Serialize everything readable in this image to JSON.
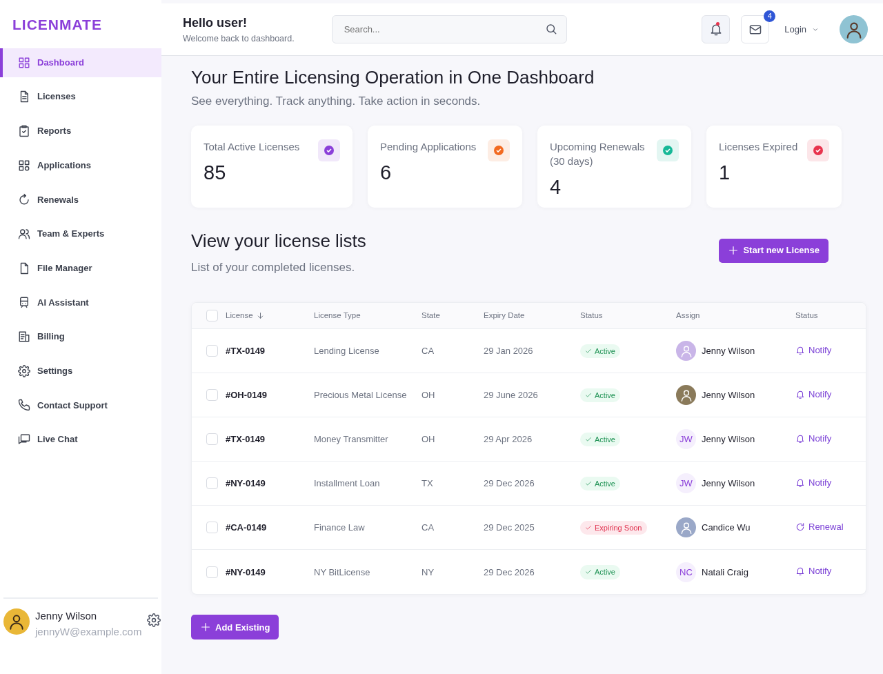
{
  "logo": "LICENMATE",
  "sidebar": {
    "items": [
      {
        "label": "Dashboard",
        "selected": true
      },
      {
        "label": "Licenses",
        "selected": false
      },
      {
        "label": "Reports",
        "selected": false
      },
      {
        "label": "Applications",
        "selected": false
      },
      {
        "label": "Renewals",
        "selected": false
      },
      {
        "label": "Team & Experts",
        "selected": false
      },
      {
        "label": "File Manager",
        "selected": false
      },
      {
        "label": "AI Assistant",
        "selected": false
      },
      {
        "label": "Billing",
        "selected": false
      },
      {
        "label": "Settings",
        "selected": false
      },
      {
        "label": "Contact Support",
        "selected": false
      },
      {
        "label": "Live Chat",
        "selected": false
      }
    ],
    "user": {
      "name": "Jenny Wilson",
      "email": "jennyW@example.com"
    }
  },
  "header": {
    "greeting": "Hello user!",
    "subtitle": "Welcome back to dashboard.",
    "search": {
      "placeholder": "Search..."
    },
    "bell_unread": true,
    "mail_count": "4",
    "login": "Login"
  },
  "hero": {
    "title": "Your Entire Licensing Operation in One Dashboard",
    "subtitle": "See everything. Track anything. Take action in seconds."
  },
  "stats": [
    {
      "label": "Total Active Licenses",
      "value": "85",
      "color": "#8b3fd9"
    },
    {
      "label": "Pending Applications",
      "value": "6",
      "color": "#f26a21"
    },
    {
      "label": "Upcoming Renewals (30 days)",
      "value": "4",
      "color": "#17b897"
    },
    {
      "label": "Licenses Expired",
      "value": "1",
      "color": "#e8344e"
    }
  ],
  "list": {
    "title": "View your license lists",
    "subtitle": "List of your completed licenses.",
    "start_button": "Start new License"
  },
  "table": {
    "select_all_checked": false,
    "columns": [
      "License",
      "License Type",
      "State",
      "Expiry Date",
      "Status",
      "Assign",
      "Status"
    ],
    "rows": [
      {
        "checked": false,
        "license": "#TX-0149",
        "type": "Lending License",
        "state": "CA",
        "expiry": "29 Jan 2026",
        "status": {
          "kind": "active",
          "label": "Active"
        },
        "assignee": {
          "kind": "photo",
          "name": "Jenny Wilson"
        },
        "action": {
          "kind": "notify",
          "label": "Notify"
        }
      },
      {
        "checked": false,
        "license": "#OH-0149",
        "type": "Precious Metal License",
        "state": "OH",
        "expiry": "29 June 2026",
        "status": {
          "kind": "active",
          "label": "Active"
        },
        "assignee": {
          "kind": "photo",
          "name": "Jenny Wilson"
        },
        "action": {
          "kind": "notify",
          "label": "Notify"
        }
      },
      {
        "checked": false,
        "license": "#TX-0149",
        "type": "Money Transmitter",
        "state": "OH",
        "expiry": "29 Apr 2026",
        "status": {
          "kind": "active",
          "label": "Active"
        },
        "assignee": {
          "kind": "initials",
          "initials": "JW",
          "name": "Jenny Wilson"
        },
        "action": {
          "kind": "notify",
          "label": "Notify"
        }
      },
      {
        "checked": false,
        "license": "#NY-0149",
        "type": "Installment Loan",
        "state": "TX",
        "expiry": "29 Dec 2026",
        "status": {
          "kind": "active",
          "label": "Active"
        },
        "assignee": {
          "kind": "initials",
          "initials": "JW",
          "name": "Jenny Wilson"
        },
        "action": {
          "kind": "notify",
          "label": "Notify"
        }
      },
      {
        "checked": false,
        "license": "#CA-0149",
        "type": "Finance Law",
        "state": "CA",
        "expiry": "29 Dec 2025",
        "status": {
          "kind": "expiring",
          "label": "Expiring Soon"
        },
        "assignee": {
          "kind": "photo",
          "name": "Candice Wu"
        },
        "action": {
          "kind": "renewal",
          "label": "Renewal"
        }
      },
      {
        "checked": false,
        "license": "#NY-0149",
        "type": "NY BitLicense",
        "state": "NY",
        "expiry": "29 Dec 2026",
        "status": {
          "kind": "active",
          "label": "Active"
        },
        "assignee": {
          "kind": "initials",
          "initials": "NC",
          "name": "Natali Craig"
        },
        "action": {
          "kind": "notify",
          "label": "Notify"
        }
      }
    ]
  },
  "add_button": "Add Existing"
}
